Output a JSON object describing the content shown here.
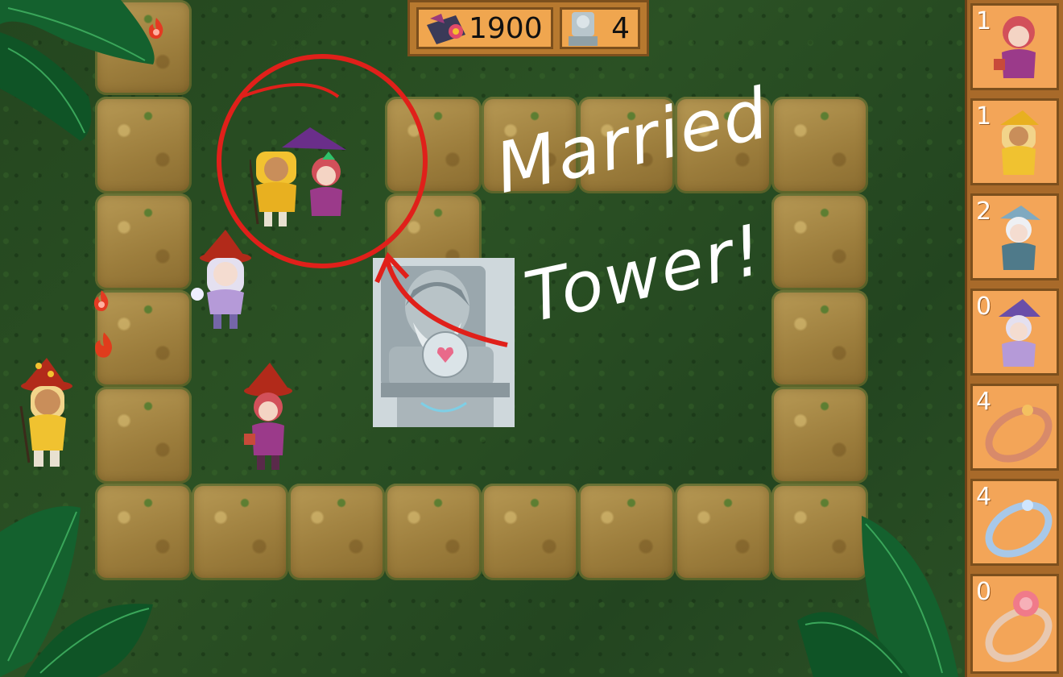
{
  "hud": {
    "gold_icon": "ore-cart-icon",
    "gold_value": "1900",
    "tower_icon": "statue-icon",
    "tower_value": "4"
  },
  "annotation": {
    "line1": "Married",
    "line2": "Tower!",
    "circle_color": "#e0201a"
  },
  "shop": [
    {
      "count": "1",
      "icon": "pink-hair-mage-icon"
    },
    {
      "count": "1",
      "icon": "blonde-mage-icon"
    },
    {
      "count": "2",
      "icon": "white-hair-mage-icon"
    },
    {
      "count": "0",
      "icon": "purple-witch-icon"
    },
    {
      "count": "4",
      "icon": "gold-ring-icon"
    },
    {
      "count": "4",
      "icon": "silver-ring-icon"
    },
    {
      "count": "0",
      "icon": "rose-ring-icon"
    }
  ],
  "colors": {
    "grass": "#2b5124",
    "path": "#a98a48",
    "panel": "#f3a558",
    "panel_border": "#7b4f1d"
  }
}
